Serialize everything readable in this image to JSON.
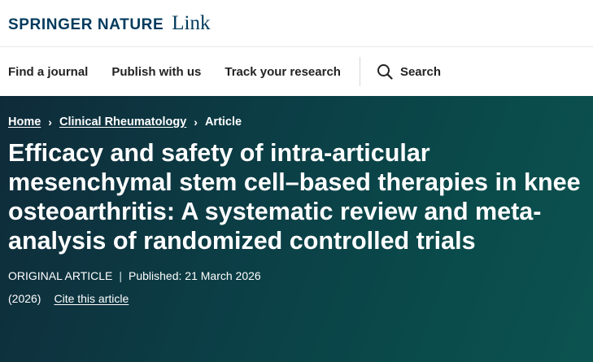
{
  "brand": {
    "name": "SPRINGER NATURE",
    "link_word": "Link"
  },
  "nav": {
    "items": [
      {
        "label": "Find a journal"
      },
      {
        "label": "Publish with us"
      },
      {
        "label": "Track your research"
      }
    ],
    "search_label": "Search",
    "search_icon": "search-icon"
  },
  "breadcrumb": {
    "home": "Home",
    "journal": "Clinical Rheumatology",
    "current": "Article",
    "separator": "›"
  },
  "article": {
    "title": "Efficacy and safety of intra-articular mesenchymal stem cell–based therapies in knee osteoarthritis: A systematic review and meta-analysis of randomized controlled trials",
    "type": "ORIGINAL ARTICLE",
    "meta_separator": "|",
    "published": "Published: 21 March 2026",
    "year": "(2026)",
    "cite_label": "Cite this article"
  },
  "colors": {
    "brand_blue": "#003a5d",
    "hero_bg": "#0b3f46",
    "text_on_hero": "#ffffff"
  }
}
